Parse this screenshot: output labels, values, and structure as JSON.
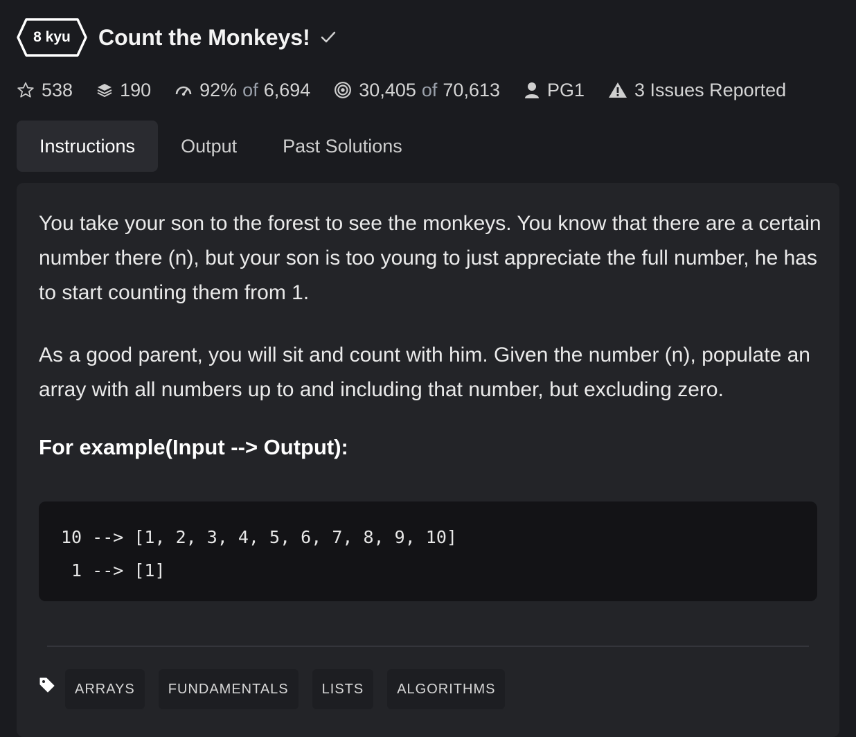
{
  "kata": {
    "rank": "8 kyu",
    "title": "Count the Monkeys!"
  },
  "stats": {
    "stars": "538",
    "collections": "190",
    "satisfaction_pct": "92%",
    "satisfaction_of": "of",
    "satisfaction_votes": "6,694",
    "completed": "30,405",
    "completed_of": "of",
    "attempted": "70,613",
    "author": "PG1",
    "issues": "3 Issues Reported"
  },
  "tabs": [
    "Instructions",
    "Output",
    "Past Solutions"
  ],
  "instructions": {
    "paragraph1": "You take your son to the forest to see the monkeys. You know that there are a certain number there (n), but your son is too young to just appreciate the full number, he has to start counting them from 1.",
    "paragraph2": "As a good parent, you will sit and count with him. Given the number (n), populate an array with all numbers up to and including that number, but excluding zero.",
    "example_heading": "For example(Input --> Output):",
    "code_lines": [
      "10 --> [1, 2, 3, 4, 5, 6, 7, 8, 9, 10]",
      " 1 --> [1]"
    ]
  },
  "tags": [
    "ARRAYS",
    "FUNDAMENTALS",
    "LISTS",
    "ALGORITHMS"
  ],
  "colors": {
    "background": "#1a1b1f",
    "panel": "#232428",
    "code_background": "#131316",
    "tab_active": "#2a2b30"
  },
  "icons": {
    "rank": "hexagon-badge",
    "check": "checkmark-icon",
    "stars": "star-outline-icon",
    "collections": "layers-icon",
    "satisfaction": "gauge-icon",
    "completed": "target-icon",
    "author": "user-icon",
    "issues": "warning-icon",
    "tags": "tag-icon"
  }
}
